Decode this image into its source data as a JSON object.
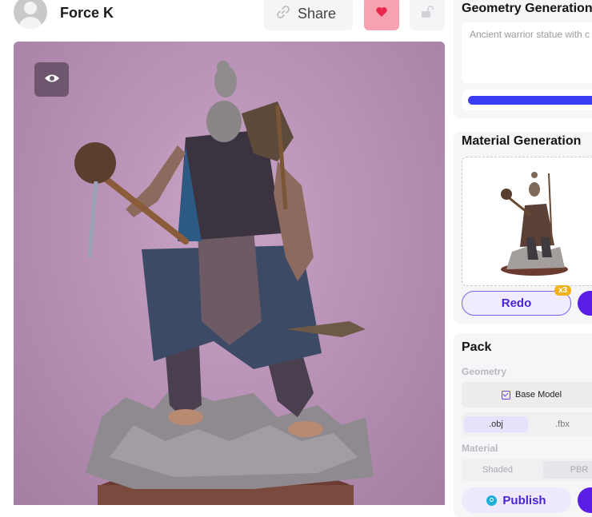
{
  "header": {
    "username": "Force K",
    "share_label": "Share"
  },
  "icons": {
    "avatar": "user-avatar-icon",
    "share": "link-icon",
    "like": "heart-icon",
    "lock": "unlock-icon",
    "view": "eye-icon",
    "publish": "publish-icon"
  },
  "colors": {
    "like_bg": "#f7a2b0",
    "accent": "#5a1ee6",
    "progress": "#3b3ef5",
    "badge": "#f2b21c",
    "viewer_bg": "#b58eb3"
  },
  "geometry_generation": {
    "title": "Geometry Generation",
    "prompt_text": "Ancient warrior statue with c",
    "progress_fraction": 1.0
  },
  "material_generation": {
    "title": "Material Generation",
    "redo_label": "Redo",
    "redo_badge": "x3"
  },
  "pack": {
    "title": "Pack",
    "geometry_label": "Geometry",
    "base_model_label": "Base Model",
    "formats": [
      ".obj",
      ".fbx"
    ],
    "selected_format": ".obj",
    "material_label": "Material",
    "material_options": [
      "Shaded",
      "PBR"
    ],
    "publish_label": "Publish"
  }
}
